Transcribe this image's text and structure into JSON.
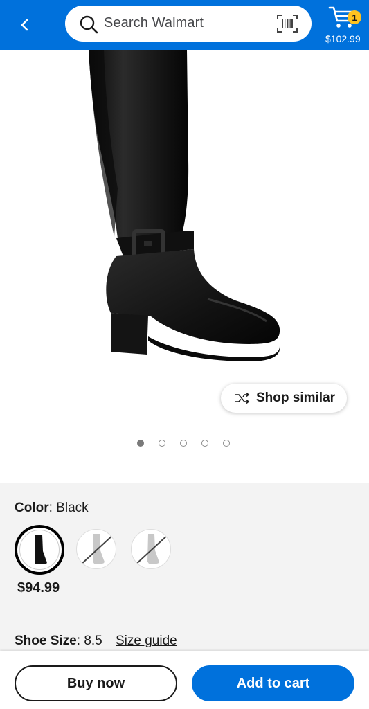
{
  "header": {
    "back_icon": "chevron-left-icon",
    "search_placeholder": "Search Walmart",
    "search_icon": "search-icon",
    "barcode_icon": "barcode-scan-icon",
    "cart": {
      "icon": "cart-icon",
      "count": "1",
      "total": "$102.99"
    },
    "colors": {
      "brand_blue": "#0071dc",
      "badge_yellow": "#ffc220"
    }
  },
  "gallery": {
    "image": "black-knee-high-boot-photo",
    "shop_similar_label": "Shop similar",
    "shop_similar_icon": "shuffle-icon",
    "dot_count": 5,
    "active_index": 0
  },
  "variants": {
    "color_key": "Color",
    "color_value": "Black",
    "swatches": [
      {
        "name": "Black",
        "selected": true,
        "available": true,
        "price": "$94.99"
      },
      {
        "selected": false,
        "available": false
      },
      {
        "selected": false,
        "available": false
      }
    ],
    "size_key": "Shoe Size",
    "size_value": "8.5",
    "size_guide_label": "Size guide"
  },
  "actions": {
    "buy_now_label": "Buy now",
    "add_to_cart_label": "Add to cart"
  }
}
